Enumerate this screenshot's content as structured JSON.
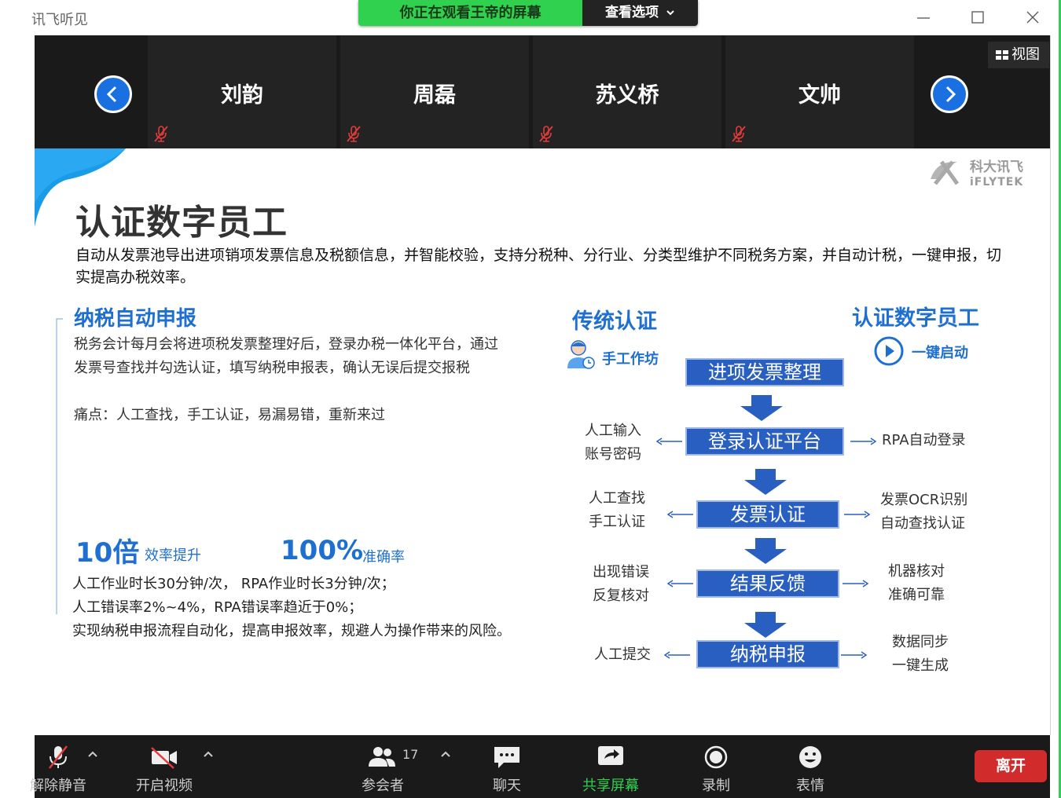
{
  "window": {
    "app_title": "讯飞听见"
  },
  "share_banner": {
    "text": "你正在观看王帝的屏幕",
    "view_options": "查看选项"
  },
  "gallery": {
    "participants": [
      "刘韵",
      "周磊",
      "苏义桥",
      "文帅"
    ],
    "view_label": "视图"
  },
  "slide": {
    "title": "认证数字员工",
    "intro": "自动从发票池导出进项销项发票信息及税额信息，并智能校验，支持分税种、分行业、分类型维护不同税务方案，并自动计税，一键申报，切实提高办税效率。",
    "section_title": "纳税自动申报",
    "section_body": "税务会计每月会将进项税发票整理好后，登录办税一体化平台，通过发票号查找并勾选认证，填写纳税申报表，确认无误后提交报税",
    "pain_points": "痛点：人工查找，手工认证，易漏易错，重新来过",
    "stats": [
      {
        "value": "10倍",
        "label": "效率提升"
      },
      {
        "value": "100%",
        "label": "准确率"
      }
    ],
    "stat_lines": [
      "人工作业时长30分钟/次， RPA作业时长3分钟/次；",
      "人工错误率2%~4%，RPA错误率趋近于0%；",
      "实现纳税申报流程自动化，提高申报效率，规避人为操作带来的风险。"
    ],
    "traditional_title": "传统认证",
    "digital_title": "认证数字员工",
    "manual_label": "手工作坊",
    "onekey_label": "一键启动",
    "steps": [
      "进项发票整理",
      "登录认证平台",
      "发票认证",
      "结果反馈",
      "纳税申报"
    ],
    "left_notes": [
      [
        "人工输入",
        "账号密码"
      ],
      [
        "人工查找",
        "手工认证"
      ],
      [
        "出现错误",
        "反复核对"
      ],
      [
        "人工提交"
      ]
    ],
    "right_notes": [
      [
        "RPA自动登录"
      ],
      [
        "发票OCR识别",
        "自动查找认证"
      ],
      [
        "机器核对",
        "准确可靠"
      ],
      [
        "数据同步",
        "一键生成"
      ]
    ],
    "logo_text": "科大讯飞",
    "logo_sub": "iFLYTEK"
  },
  "toolbar": {
    "unmute": "解除静音",
    "start_video": "开启视频",
    "participants": "参会者",
    "participant_count": "17",
    "chat": "聊天",
    "share_screen": "共享屏幕",
    "record": "录制",
    "reactions": "表情",
    "leave": "离开"
  },
  "colors": {
    "accent": "#1e6fcf",
    "step_fill": "#2a5fc2",
    "share_green": "#2fd14e",
    "leave_red": "#d12b2b"
  }
}
